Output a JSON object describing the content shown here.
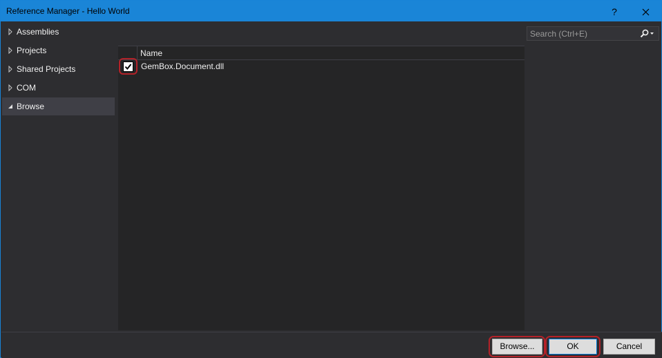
{
  "window": {
    "title": "Reference Manager - Hello World",
    "help_label": "?",
    "accent_color": "#1a85d7"
  },
  "nav": {
    "items": [
      {
        "label": "Assemblies",
        "icon": "triangle-right-icon",
        "selected": false
      },
      {
        "label": "Projects",
        "icon": "triangle-right-icon",
        "selected": false
      },
      {
        "label": "Shared Projects",
        "icon": "triangle-right-icon",
        "selected": false
      },
      {
        "label": "COM",
        "icon": "triangle-right-icon",
        "selected": false
      },
      {
        "label": "Browse",
        "icon": "triangle-expanded-icon",
        "selected": true
      }
    ]
  },
  "search": {
    "placeholder": "Search (Ctrl+E)",
    "icon": "search-icon"
  },
  "list": {
    "column_name": "Name",
    "rows": [
      {
        "checked": true,
        "name": "GemBox.Document.dll"
      }
    ]
  },
  "footer": {
    "browse_label": "Browse...",
    "ok_label": "OK",
    "cancel_label": "Cancel"
  },
  "highlight_color": "#b32229"
}
